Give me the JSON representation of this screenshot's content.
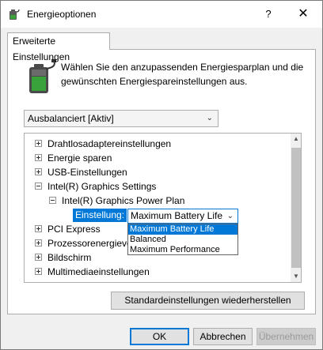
{
  "window": {
    "title": "Energieoptionen",
    "help_label": "?",
    "close_label": "✕"
  },
  "tab": {
    "label": "Erweiterte Einstellungen"
  },
  "intro": {
    "text": "Wählen Sie den anzupassenden Energiesparplan und die gewünschten Energiespareinstellungen aus."
  },
  "plan_select": {
    "value": "Ausbalanciert [Aktiv]"
  },
  "tree": {
    "items": [
      {
        "label": "Drahtlosadaptereinstellungen",
        "expander": "plus",
        "level": 0
      },
      {
        "label": "Energie sparen",
        "expander": "plus",
        "level": 0
      },
      {
        "label": "USB-Einstellungen",
        "expander": "plus",
        "level": 0
      },
      {
        "label": "Intel(R) Graphics Settings",
        "expander": "minus",
        "level": 0
      },
      {
        "label": "Intel(R) Graphics Power Plan",
        "expander": "minus",
        "level": 1
      },
      {
        "label": "",
        "expander": "none",
        "level": 2
      },
      {
        "label": "PCI Express",
        "expander": "plus",
        "level": 0
      },
      {
        "label": "Prozessorenergieverwaltung",
        "expander": "plus",
        "level": 0
      },
      {
        "label": "Bildschirm",
        "expander": "plus",
        "level": 0
      },
      {
        "label": "Multimediaeinstellungen",
        "expander": "plus",
        "level": 0
      }
    ],
    "setting": {
      "label": "Einstellung:",
      "value": "Maximum Battery Life",
      "options": [
        "Maximum Battery Life",
        "Balanced",
        "Maximum Performance"
      ],
      "selected_index": 0
    }
  },
  "buttons": {
    "restore": "Standardeinstellungen wiederherstellen",
    "ok": "OK",
    "cancel": "Abbrechen",
    "apply": "Übernehmen"
  },
  "colors": {
    "accent": "#0078d7",
    "icon_green": "#3aa23a"
  }
}
